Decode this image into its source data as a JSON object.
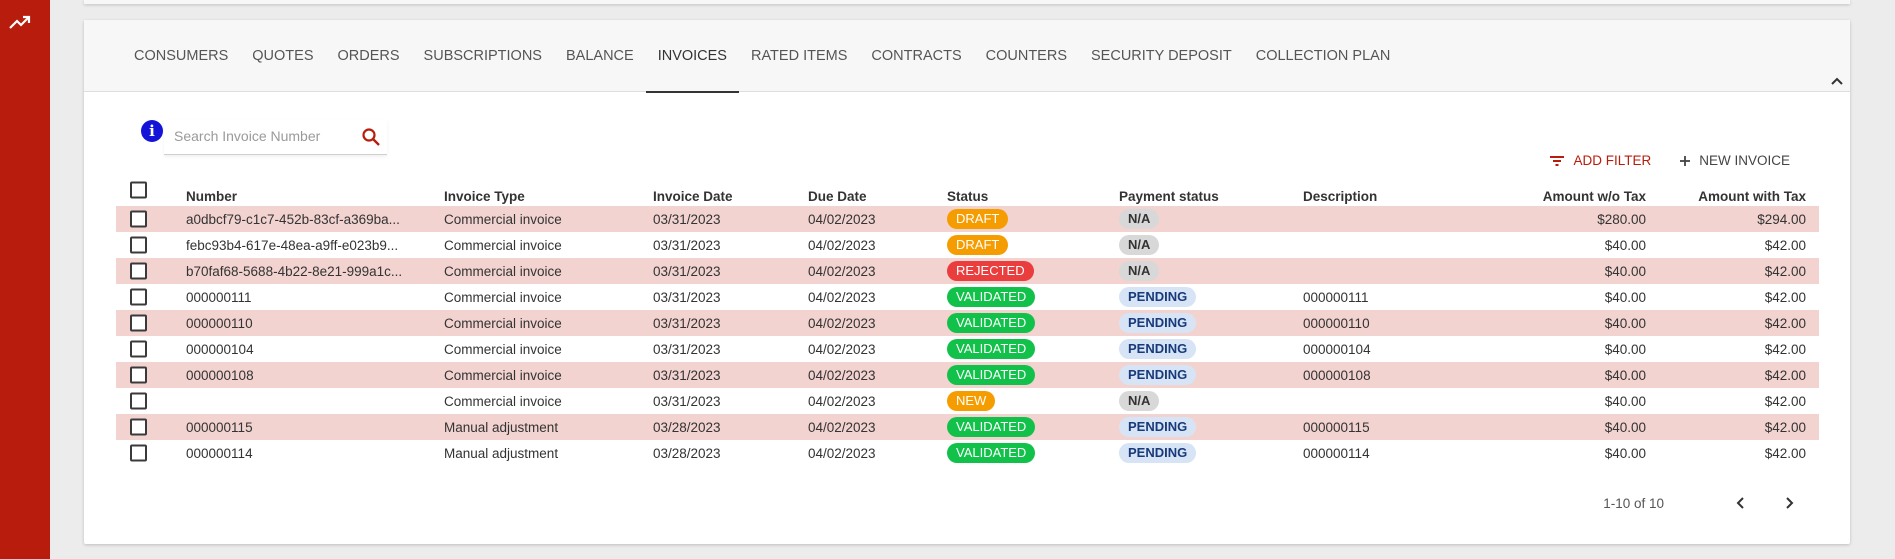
{
  "tabs": [
    {
      "label": "CONSUMERS",
      "active": false
    },
    {
      "label": "QUOTES",
      "active": false
    },
    {
      "label": "ORDERS",
      "active": false
    },
    {
      "label": "SUBSCRIPTIONS",
      "active": false
    },
    {
      "label": "BALANCE",
      "active": false
    },
    {
      "label": "INVOICES",
      "active": true
    },
    {
      "label": "RATED ITEMS",
      "active": false
    },
    {
      "label": "CONTRACTS",
      "active": false
    },
    {
      "label": "COUNTERS",
      "active": false
    },
    {
      "label": "SECURITY DEPOSIT",
      "active": false
    },
    {
      "label": "COLLECTION PLAN",
      "active": false
    }
  ],
  "search": {
    "placeholder": "Search Invoice Number",
    "value": ""
  },
  "toolbar": {
    "add_filter_label": "ADD FILTER",
    "new_invoice_label": "NEW INVOICE"
  },
  "columns": {
    "number": "Number",
    "invoice_type": "Invoice Type",
    "invoice_date": "Invoice Date",
    "due_date": "Due Date",
    "status": "Status",
    "payment_status": "Payment status",
    "description": "Description",
    "amount_wo_tax": "Amount w/o Tax",
    "amount_with_tax": "Amount with Tax"
  },
  "rows": [
    {
      "number": "a0dbcf79-c1c7-452b-83cf-a369ba...",
      "invoice_type": "Commercial invoice",
      "invoice_date": "03/31/2023",
      "due_date": "04/02/2023",
      "status": "DRAFT",
      "payment_status": "N/A",
      "description": "",
      "amount_wo_tax": "$280.00",
      "amount_with_tax": "$294.00"
    },
    {
      "number": "febc93b4-617e-48ea-a9ff-e023b9...",
      "invoice_type": "Commercial invoice",
      "invoice_date": "03/31/2023",
      "due_date": "04/02/2023",
      "status": "DRAFT",
      "payment_status": "N/A",
      "description": "",
      "amount_wo_tax": "$40.00",
      "amount_with_tax": "$42.00"
    },
    {
      "number": "b70faf68-5688-4b22-8e21-999a1c...",
      "invoice_type": "Commercial invoice",
      "invoice_date": "03/31/2023",
      "due_date": "04/02/2023",
      "status": "REJECTED",
      "payment_status": "N/A",
      "description": "",
      "amount_wo_tax": "$40.00",
      "amount_with_tax": "$42.00"
    },
    {
      "number": "000000111",
      "invoice_type": "Commercial invoice",
      "invoice_date": "03/31/2023",
      "due_date": "04/02/2023",
      "status": "VALIDATED",
      "payment_status": "PENDING",
      "description": "000000111",
      "amount_wo_tax": "$40.00",
      "amount_with_tax": "$42.00"
    },
    {
      "number": "000000110",
      "invoice_type": "Commercial invoice",
      "invoice_date": "03/31/2023",
      "due_date": "04/02/2023",
      "status": "VALIDATED",
      "payment_status": "PENDING",
      "description": "000000110",
      "amount_wo_tax": "$40.00",
      "amount_with_tax": "$42.00"
    },
    {
      "number": "000000104",
      "invoice_type": "Commercial invoice",
      "invoice_date": "03/31/2023",
      "due_date": "04/02/2023",
      "status": "VALIDATED",
      "payment_status": "PENDING",
      "description": "000000104",
      "amount_wo_tax": "$40.00",
      "amount_with_tax": "$42.00"
    },
    {
      "number": "000000108",
      "invoice_type": "Commercial invoice",
      "invoice_date": "03/31/2023",
      "due_date": "04/02/2023",
      "status": "VALIDATED",
      "payment_status": "PENDING",
      "description": "000000108",
      "amount_wo_tax": "$40.00",
      "amount_with_tax": "$42.00"
    },
    {
      "number": "",
      "invoice_type": "Commercial invoice",
      "invoice_date": "03/31/2023",
      "due_date": "04/02/2023",
      "status": "NEW",
      "payment_status": "N/A",
      "description": "",
      "amount_wo_tax": "$40.00",
      "amount_with_tax": "$42.00"
    },
    {
      "number": "000000115",
      "invoice_type": "Manual adjustment",
      "invoice_date": "03/28/2023",
      "due_date": "04/02/2023",
      "status": "VALIDATED",
      "payment_status": "PENDING",
      "description": "000000115",
      "amount_wo_tax": "$40.00",
      "amount_with_tax": "$42.00"
    },
    {
      "number": "000000114",
      "invoice_type": "Manual adjustment",
      "invoice_date": "03/28/2023",
      "due_date": "04/02/2023",
      "status": "VALIDATED",
      "payment_status": "PENDING",
      "description": "000000114",
      "amount_wo_tax": "$40.00",
      "amount_with_tax": "$42.00"
    }
  ],
  "pagination": {
    "range_label": "1-10 of 10"
  },
  "colors": {
    "sidebar": "#b71c0c",
    "row_alt": "#f2d3d0",
    "draft": "#f59d00",
    "rejected": "#ea3d3d",
    "validated": "#12c14a",
    "pending_bg": "#d6e4f6",
    "na_bg": "#d8d8d8",
    "info": "#1414d8"
  },
  "icons": [
    "trending-up-icon",
    "chevron-up-icon",
    "info-icon",
    "search-icon",
    "filter-icon",
    "plus-icon",
    "chevron-left-icon",
    "chevron-right-icon"
  ]
}
